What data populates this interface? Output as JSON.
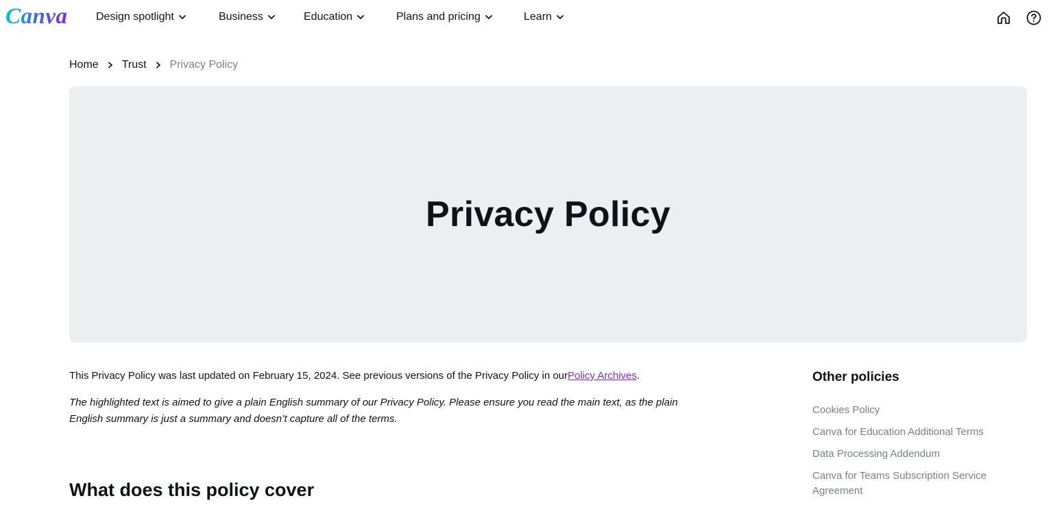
{
  "nav": {
    "logo": "Canva",
    "items": [
      {
        "label": "Design spotlight"
      },
      {
        "label": "Business"
      },
      {
        "label": "Education"
      },
      {
        "label": "Plans and pricing"
      },
      {
        "label": "Learn"
      }
    ],
    "icons": [
      "home-icon",
      "help-icon"
    ]
  },
  "breadcrumb": {
    "home": "Home",
    "trust": "Trust",
    "current": "Privacy Policy"
  },
  "hero": {
    "title": "Privacy Policy"
  },
  "content": {
    "updated_prefix": "This Privacy Policy was last updated on February 15, 2024. See previous versions of the Privacy Policy in our",
    "archives_link": "Policy Archives",
    "updated_suffix": ".",
    "summary": "The highlighted text is aimed to give a plain English summary of our Privacy Policy. Please ensure you read the main text, as the plain English summary is just a summary and doesn’t capture all of the terms.",
    "section_title": "What does this policy cover"
  },
  "sidebar": {
    "title": "Other policies",
    "links": [
      "Cookies Policy",
      "Canva for Education Additional Terms",
      "Data Processing Addendum",
      "Canva for Teams Subscription Service Agreement"
    ]
  },
  "colors": {
    "accent": "#7d2ae8",
    "hero_bg": "#eceff2",
    "muted_text": "#7a7f85"
  }
}
